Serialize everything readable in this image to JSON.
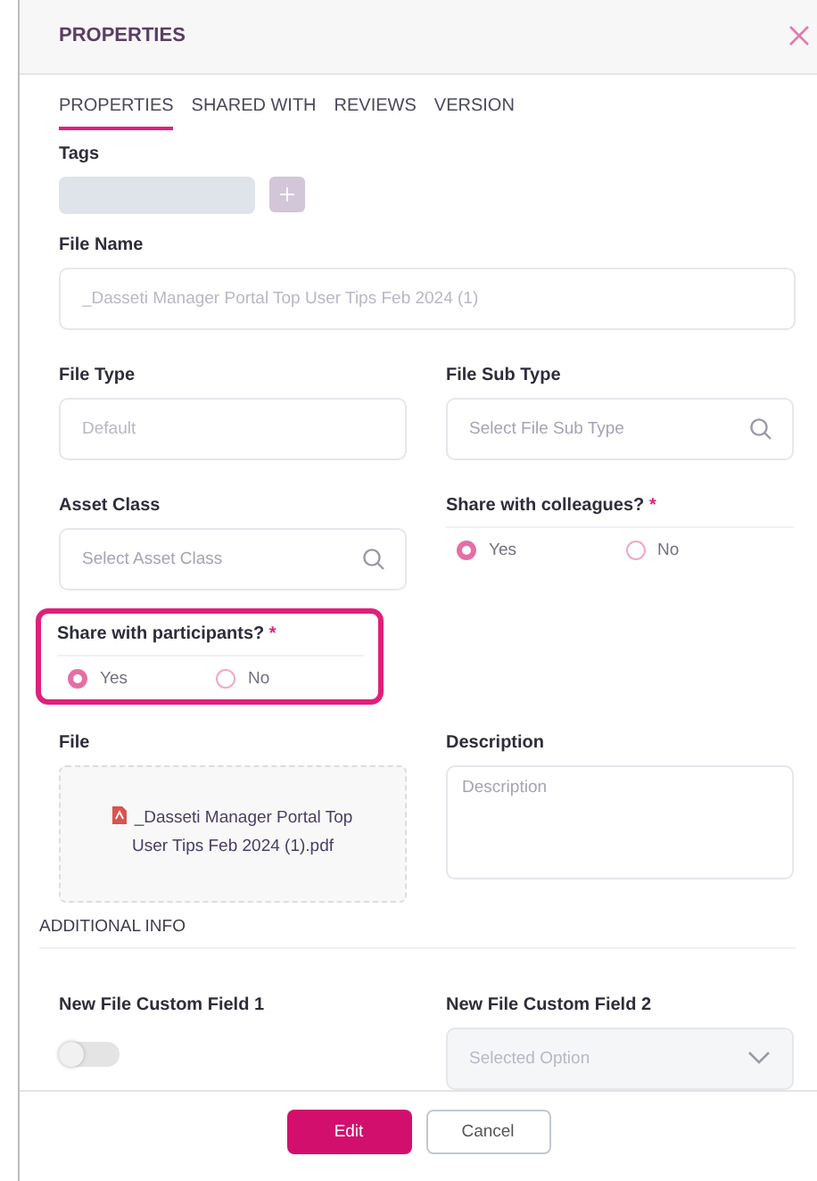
{
  "window": {
    "title": "PROPERTIES"
  },
  "tabs": [
    {
      "label": "PROPERTIES",
      "selected": true
    },
    {
      "label": "SHARED WITH",
      "selected": false
    },
    {
      "label": "REVIEWS",
      "selected": false
    },
    {
      "label": "VERSION",
      "selected": false
    }
  ],
  "tags": {
    "label": "Tags"
  },
  "file_name": {
    "label": "File Name",
    "value": "_Dasseti Manager Portal Top User Tips Feb 2024 (1)"
  },
  "file_type": {
    "label": "File Type",
    "value": "Default"
  },
  "file_sub_type": {
    "label": "File Sub Type",
    "placeholder": "Select File Sub Type"
  },
  "asset_class": {
    "label": "Asset Class",
    "placeholder": "Select Asset Class"
  },
  "share_with_colleagues": {
    "label": "Share with colleagues?",
    "required_mark": "*",
    "highlighted": false,
    "options": [
      {
        "label": "Yes",
        "selected": true
      },
      {
        "label": "No",
        "selected": false
      }
    ]
  },
  "share_with_participants": {
    "label": "Share with participants?",
    "required_mark": "*",
    "highlighted": true,
    "options": [
      {
        "label": "Yes",
        "selected": true
      },
      {
        "label": "No",
        "selected": false
      }
    ]
  },
  "file": {
    "label": "File",
    "name": "_Dasseti Manager Portal Top User Tips Feb 2024 (1).pdf"
  },
  "description": {
    "label": "Description",
    "placeholder": "Description"
  },
  "additional_info": {
    "title": "ADDITIONAL INFO"
  },
  "custom_field_1": {
    "label": "New File Custom Field 1",
    "on": false
  },
  "custom_field_2": {
    "label": "New File Custom Field 2",
    "value": "Selected Option",
    "disabled": true
  },
  "buttons": [
    {
      "label": "Edit",
      "kind": "primary"
    },
    {
      "label": "Cancel",
      "kind": "secondary"
    }
  ]
}
